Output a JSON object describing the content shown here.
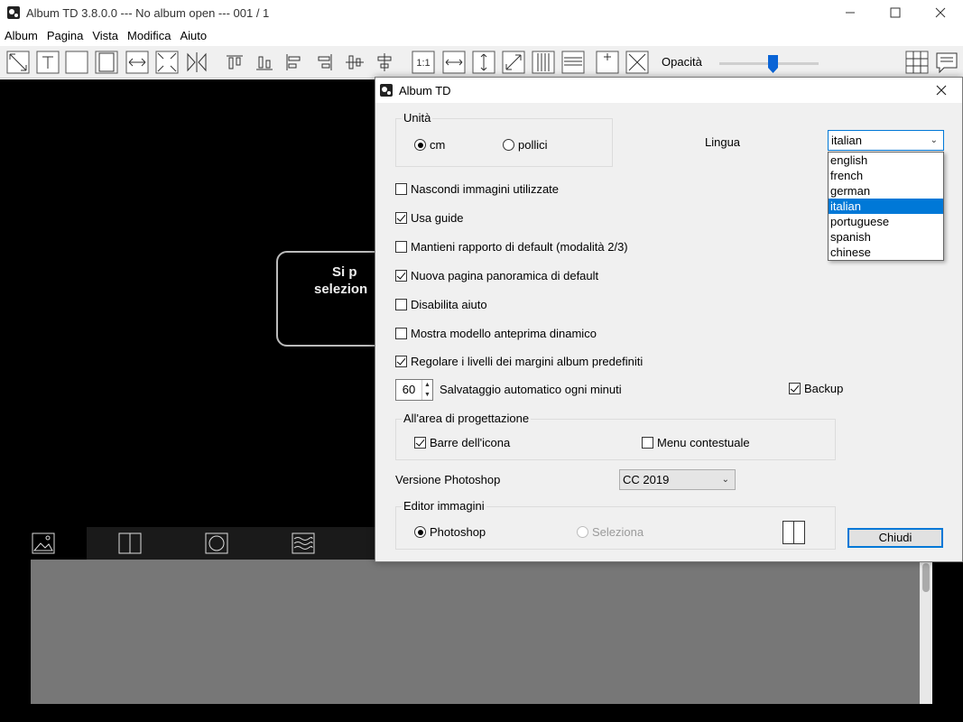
{
  "window": {
    "title": "Album TD 3.8.0.0 --- No album open --- 001 / 1",
    "controls": [
      "minimize",
      "maximize",
      "close"
    ]
  },
  "menu": [
    "Album",
    "Pagina",
    "Vista",
    "Modifica",
    "Aiuto"
  ],
  "toolbar": {
    "opacity_label": "Opacità",
    "opacity_value": 0.55,
    "accent": "#0a64d6",
    "icons": [
      "select-frame-icon",
      "text-frame-icon",
      "empty-frame-icon",
      "fit-frame-icon",
      "stretch-h-icon",
      "full-bleed-icon",
      "mirror-icon",
      "align-top-icon",
      "align-bottom-icon",
      "align-left-icon",
      "align-right-icon",
      "center-v-icon",
      "center-h-icon",
      "actual-size-icon",
      "fit-width-icon",
      "fit-height-icon",
      "fit-diagonal-icon",
      "columns-icon",
      "rows-icon",
      "add-frame-icon",
      "delete-frame-icon",
      "grid-icon",
      "notes-icon"
    ]
  },
  "canvas": {
    "hint_line1": "Si p",
    "hint_line2": "selezion"
  },
  "bottom_tabs": [
    "image-icon",
    "split-page-icon",
    "circle-icon",
    "wave-pattern-icon"
  ],
  "dialog": {
    "title": "Album TD",
    "units": {
      "group_label": "Unità",
      "options": [
        "cm",
        "pollici"
      ],
      "selected": "cm"
    },
    "language": {
      "label": "Lingua",
      "value": "italian",
      "options": [
        "english",
        "french",
        "german",
        "italian",
        "portuguese",
        "spanish",
        "chinese"
      ],
      "selected_index": 3
    },
    "checkboxes": [
      {
        "label": "Nascondi immagini utilizzate",
        "checked": false
      },
      {
        "label": "Usa guide",
        "checked": true
      },
      {
        "label": "Mantieni rapporto di default (modalità 2/3)",
        "checked": false
      },
      {
        "label": "Nuova pagina panoramica di default",
        "checked": true
      },
      {
        "label": "Disabilita aiuto",
        "checked": false
      },
      {
        "label": "Mostra modello anteprima dinamico",
        "checked": false
      },
      {
        "label": "Regolare i livelli dei margini album predefiniti",
        "checked": true
      }
    ],
    "autosave": {
      "value": "60",
      "label": "Salvataggio automatico ogni minuti"
    },
    "backup": {
      "label": "Backup",
      "checked": true
    },
    "design_area": {
      "group_label": "All'area di progettazione",
      "icon_bars": {
        "label": "Barre dell'icona",
        "checked": true
      },
      "context_menu": {
        "label": "Menu contestuale",
        "checked": false
      }
    },
    "photoshop_version": {
      "label": "Versione Photoshop",
      "value": "CC 2019"
    },
    "image_editor": {
      "group_label": "Editor immagini",
      "options": [
        "Photoshop",
        "Seleziona"
      ],
      "selected": "Photoshop"
    },
    "close_button": "Chiudi"
  }
}
